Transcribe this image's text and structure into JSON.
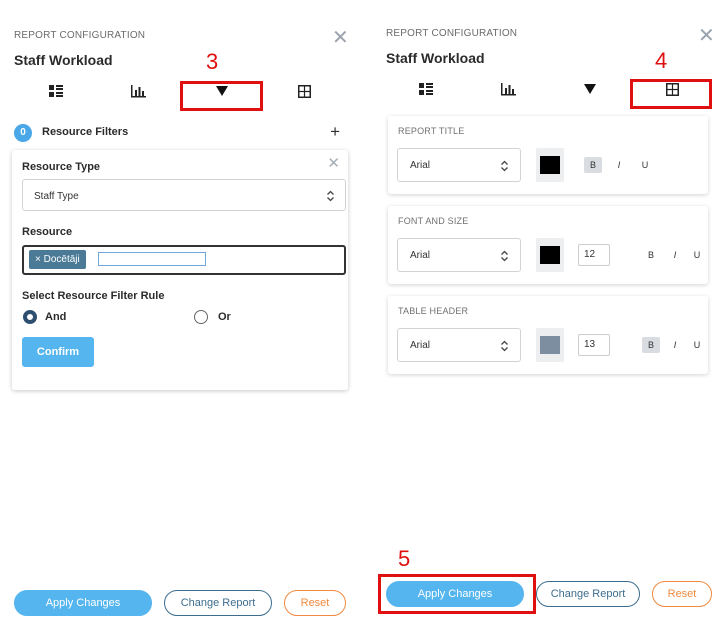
{
  "annotations": {
    "step3": "3",
    "step4": "4",
    "step5": "5"
  },
  "left_panel": {
    "subtitle": "REPORT CONFIGURATION",
    "title": "Staff Workload",
    "close_glyph": "✕",
    "tabs": [
      {
        "icon": "list-icon"
      },
      {
        "icon": "bar-chart-icon"
      },
      {
        "icon": "filter-icon"
      },
      {
        "icon": "table-icon"
      }
    ],
    "filters": {
      "count": "0",
      "label": "Resource Filters",
      "add_glyph": "+"
    },
    "filter_card": {
      "close_glyph": "✕",
      "resource_type_label": "Resource Type",
      "resource_type_value": "Staff Type",
      "resource_label": "Resource",
      "resource_tag": "× Docētāji",
      "rule_label": "Select Resource Filter Rule",
      "rule_options": [
        "And",
        "Or"
      ],
      "rule_selected": "And",
      "confirm_label": "Confirm"
    },
    "footer": {
      "apply": "Apply Changes",
      "change": "Change Report",
      "reset": "Reset"
    }
  },
  "right_panel": {
    "subtitle": "REPORT CONFIGURATION",
    "title": "Staff Workload",
    "close_glyph": "✕",
    "sections": [
      {
        "title": "REPORT TITLE",
        "font": "Arial",
        "color": "#000000",
        "size": "",
        "bold": "B",
        "italic": "I",
        "underline": "U",
        "bold_active": true
      },
      {
        "title": "FONT AND SIZE",
        "font": "Arial",
        "color": "#000000",
        "size": "12",
        "bold": "B",
        "italic": "I",
        "underline": "U",
        "bold_active": false
      },
      {
        "title": "TABLE HEADER",
        "font": "Arial",
        "color": "#7d8ea0",
        "size": "13",
        "bold": "B",
        "italic": "I",
        "underline": "U",
        "bold_active": true
      }
    ],
    "footer": {
      "apply": "Apply Changes",
      "change": "Change Report",
      "reset": "Reset"
    }
  },
  "colors": {
    "accent": "#55b5ee",
    "annotation": "#e01010",
    "outline": "#3d6d8e",
    "reset": "#f08a40"
  }
}
